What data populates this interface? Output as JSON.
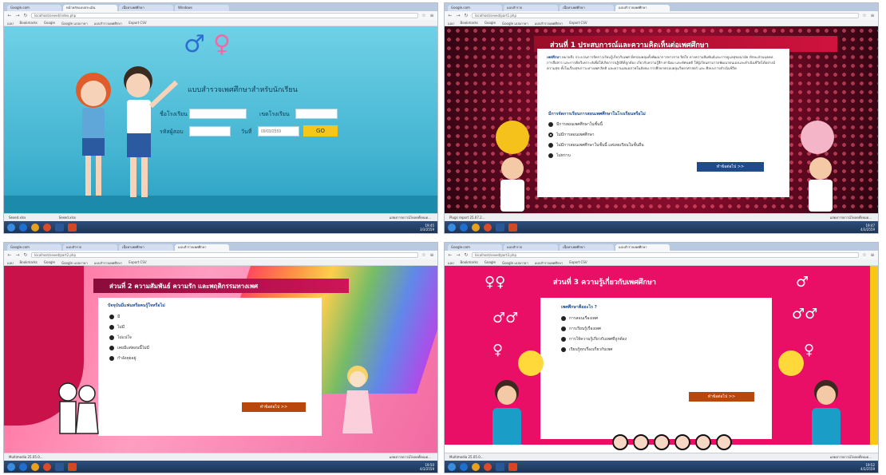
{
  "colors": {
    "taskbar": "#1b3456",
    "q1_bg": "#42b3d1",
    "q1_button": "#f5c719",
    "q2_bg": "#6b0924",
    "q2_next": "#1f4b8c",
    "q3_bg": "#ff9ec1",
    "q3_next": "#b9470b",
    "q4_bg": "#e90f67",
    "question_text": "#1a4d9a"
  },
  "q1": {
    "tabs": [
      "Google.com",
      "หน้าหลักแบบประเมิน",
      "เนื้อหาเพศศึกษา",
      "Windows"
    ],
    "url": "localhost/sexed/index.php",
    "bookmarks": [
      "แอป",
      "Bookmarks",
      "Google",
      "Google แปลภาษา",
      "แบบสำรวจเพศศึกษา",
      "Export CSV"
    ],
    "symbols": {
      "male": "♂",
      "female": "♀"
    },
    "title": "แบบสำรวจเพศศึกษาสำหรับนักเรียน",
    "school_label": "ชื่อโรงเรียน",
    "school_placeholder": "",
    "district_label": "เขตโรงเรียน",
    "district_placeholder": "",
    "student_id_label": "รหัสผู้สอบ",
    "date_label": "วันที่",
    "date_value": "09/03/2559",
    "go_label": "GO",
    "downloads": [
      "Sexed.xlsx",
      "Sexed.xlsx"
    ],
    "dl_more": "แสดงการดาวน์โหลดทั้งหมด...",
    "clock_time": "19:45",
    "clock_date": "3/3/2559"
  },
  "q2": {
    "tabs": [
      "Google.com",
      "แบบสำรวจ",
      "เนื้อหาเพศศึกษา",
      "แบบสำรวจเพศศึกษา"
    ],
    "url": "localhost/sexed/part1.php",
    "bookmarks": [
      "แอป",
      "Bookmarks",
      "Google",
      "Google แปลภาษา",
      "แบบสำรวจเพศศึกษา",
      "Export CSV"
    ],
    "banner": "ส่วนที่ 1 ประสบการณ์และความคิดเห็นต่อเพศศึกษา",
    "paragraph_lead": "เพศศึกษา",
    "paragraph": " หมายถึง กระบวนการจัดการเรียนรู้เกี่ยวกับเพศ ที่ครอบคลุมทั้งพัฒนาการทางกาย จิตใจ ทางความสัมพันธ์และการดูแลสุขอนามัย ทักษะส่วนบุคคล การสื่อสาร และการคิดวิเคราะห์เพื่อให้เกิดการปฏิบัติที่ถูกต้อง เกี่ยวกับความรู้สึก ค่านิยม และทัศนคติ ให้ผู้เรียนสามารถพัฒนาตนเองและดำเนินชีวิตได้อย่างมีความสุข ทั้งในเรื่องสุขภาวะทางเพศ สิทธิ และความเสมอภาคในสังคม การศึกษาครอบคลุมวิทยาศาสตร์ และ ศิลปะการดำเนินชีวิต",
    "question": "มีการจัดการเรียนการสอนเพศศึกษาในโรงเรียนหรือไม่",
    "options": [
      "มีการสอนเพศศึกษาในชั้นนี้",
      "ไม่มีการสอนเพศศึกษา",
      "ไม่มีการสอนเพศศึกษาในชั้นนี้ แต่เคยเรียนในชั้นอื่น",
      "ไม่ทราบ"
    ],
    "selected": 1,
    "next": "ทำข้อต่อไป >>",
    "download": "Plugs report 25.07.2...",
    "dl_more": "แสดงการดาวน์โหลดทั้งหมด...",
    "clock_time": "19:47",
    "clock_date": "4/3/2559"
  },
  "q3": {
    "tabs": [
      "Google.com",
      "แบบสำรวจ",
      "เนื้อหาเพศศึกษา",
      "แบบสำรวจเพศศึกษา"
    ],
    "url": "localhost/sexed/part2.php",
    "bookmarks": [
      "แอป",
      "Bookmarks",
      "Google",
      "Google แปลภาษา",
      "แบบสำรวจเพศศึกษา",
      "Export CSV"
    ],
    "banner": "ส่วนที่ 2 ความสัมพันธ์ ความรัก และพฤติกรรมทางเพศ",
    "question": "ปัจจุบันมีแฟนหรือคนรู้ใจหรือไม่",
    "options": [
      "มี",
      "ไม่มี",
      "ไม่แน่ใจ",
      "เคยมีแต่ตอนนี้ไม่มี",
      "กำลังคุยอยู่"
    ],
    "next": "ทำข้อต่อไป >>",
    "download": "Multimedia 25.05.0...",
    "dl_more": "แสดงการดาวน์โหลดทั้งหมด...",
    "clock_time": "19:50",
    "clock_date": "4/3/2559"
  },
  "q4": {
    "tabs": [
      "Google.com",
      "แบบสำรวจ",
      "เนื้อหาเพศศึกษา",
      "แบบสำรวจเพศศึกษา"
    ],
    "url": "localhost/sexed/part3.php",
    "bookmarks": [
      "แอป",
      "Bookmarks",
      "Google",
      "Google แปลภาษา",
      "แบบสำรวจเพศศึกษา",
      "Export CSV"
    ],
    "banner": "ส่วนที่ 3 ความรู้เกี่ยวกับเพศศึกษา",
    "question": "เพศศึกษาคืออะไร ?",
    "options": [
      "การสอนเรื่องเพศ",
      "การเรียนรู้เรื่องเพศ",
      "การให้ความรู้เกี่ยวกับเพศที่ถูกต้อง",
      "เรียนรู้ทุกเรื่องเกี่ยวกับเพศ"
    ],
    "next": "ทำข้อต่อไป >>",
    "download": "Multimedia 25.05.0...",
    "dl_more": "แสดงการดาวน์โหลดทั้งหมด...",
    "clock_time": "19:52",
    "clock_date": "4/3/2559"
  }
}
